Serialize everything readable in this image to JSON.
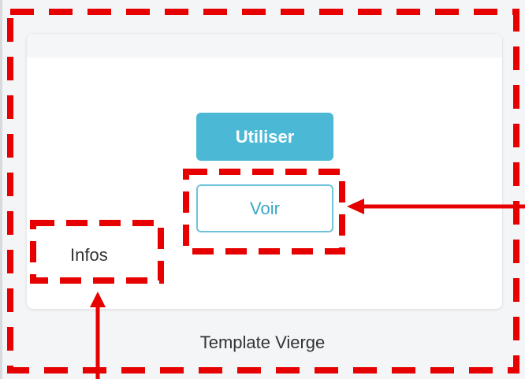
{
  "template_card": {
    "use_button_label": "Utiliser",
    "view_button_label": "Voir",
    "info_link_label": "Infos",
    "caption": "Template Vierge"
  },
  "colors": {
    "page_background": "#f4f5f7",
    "card_background": "#ffffff",
    "primary_button": "#4bb8d6",
    "outline_button_border": "#6fc4db",
    "outline_button_text": "#3aa7c9",
    "annotation": "#e60000",
    "text": "#333333"
  },
  "annotations": {
    "highlight_boxes": [
      "template-card-area",
      "view-button-area",
      "infos-link-area"
    ],
    "arrows_point_to": [
      "view-button",
      "infos-link"
    ]
  }
}
